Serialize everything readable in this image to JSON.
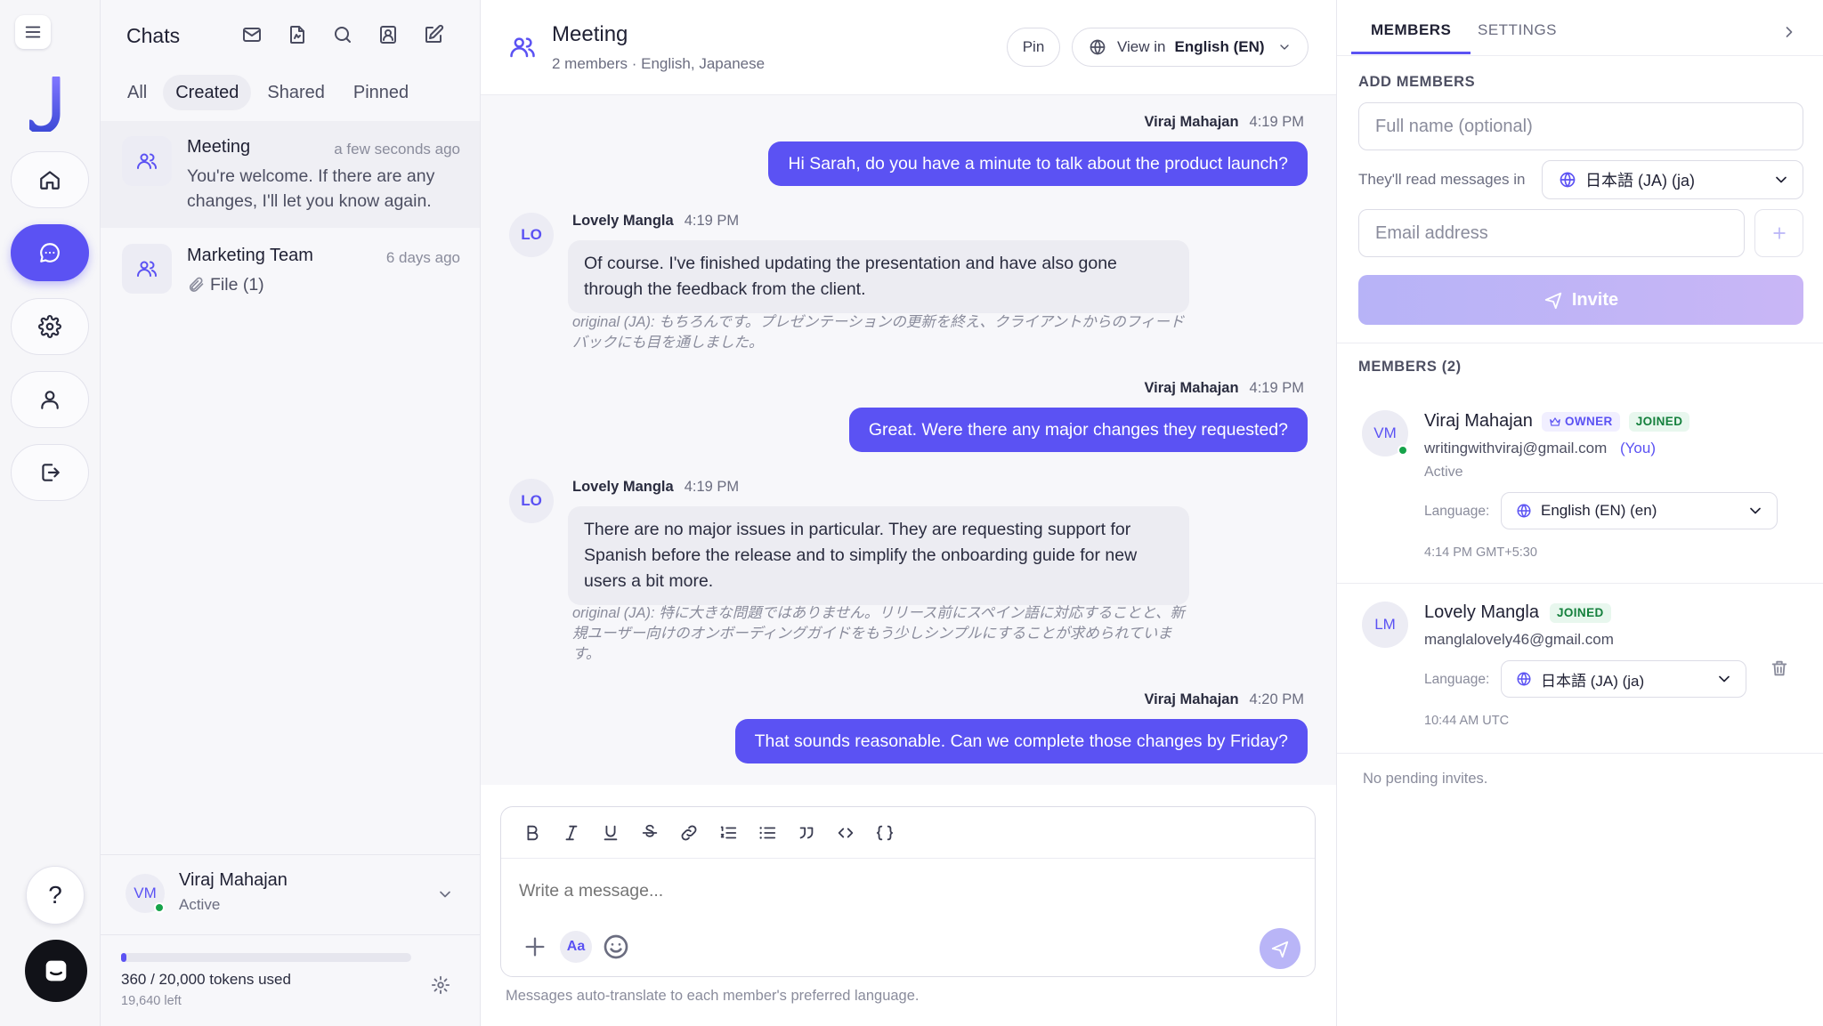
{
  "rail": {
    "help_label": "?",
    "active_color": "#5b52f3"
  },
  "chats_panel": {
    "title": "Chats",
    "filters": [
      "All",
      "Created",
      "Shared",
      "Pinned"
    ],
    "items": [
      {
        "name": "Meeting",
        "time": "a few seconds ago",
        "preview": "You're welcome. If there are any changes, I'll let you know again."
      },
      {
        "name": "Marketing Team",
        "time": "6 days ago",
        "preview": "File (1)"
      }
    ],
    "user": {
      "initials": "VM",
      "name": "Viraj Mahajan",
      "status": "Active"
    },
    "tokens": {
      "used_label": "360 / 20,000 tokens used",
      "left_label": "19,640 left",
      "fraction": 0.018
    }
  },
  "conversation": {
    "title": "Meeting",
    "subtitle": "2 members · English, Japanese",
    "pin_label": "Pin",
    "view_in_label": "View in",
    "view_in_value": "English (EN)",
    "messages": [
      {
        "sender": "Viraj Mahajan",
        "time": "4:19 PM",
        "text": "Hi Sarah, do you have a minute to talk about the product launch?"
      },
      {
        "sender": "Lovely Mangla",
        "initials": "LO",
        "time": "4:19 PM",
        "text": "Of course. I've finished updating the presentation and have also gone through the feedback from the client.",
        "original": "original (JA): もちろんです。プレゼンテーションの更新を終え、クライアントからのフィードバックにも目を通しました。"
      },
      {
        "sender": "Viraj Mahajan",
        "time": "4:19 PM",
        "text": "Great. Were there any major changes they requested?"
      },
      {
        "sender": "Lovely Mangla",
        "initials": "LO",
        "time": "4:19 PM",
        "text": "There are no major issues in particular. They are requesting support for Spanish before the release and to simplify the onboarding guide for new users a bit more.",
        "original": "original (JA): 特に大きな問題ではありません。リリース前にスペイン語に対応することと、新規ユーザー向けのオンボーディングガイドをもう少しシンプルにすることが求められています。"
      },
      {
        "sender": "Viraj Mahajan",
        "time": "4:20 PM",
        "text": "That sounds reasonable. Can we complete those changes by Friday?"
      }
    ],
    "composer": {
      "placeholder": "Write a message...",
      "aa_label": "Aa"
    },
    "hint": "Messages auto-translate to each member's preferred language."
  },
  "right_panel": {
    "tabs": [
      "MEMBERS",
      "SETTINGS"
    ],
    "add_members_label": "ADD MEMBERS",
    "full_name_placeholder": "Full name (optional)",
    "read_in_label": "They'll read messages in",
    "read_in_value": "日本語 (JA) (ja)",
    "email_placeholder": "Email address",
    "invite_label": "Invite",
    "members_label": "MEMBERS (2)",
    "members": [
      {
        "initials": "VM",
        "name": "Viraj Mahajan",
        "owner_badge": "OWNER",
        "joined_badge": "JOINED",
        "email": "writingwithviraj@gmail.com",
        "you_label": "(You)",
        "status": "Active",
        "language_label": "Language:",
        "language": "English (EN) (en)",
        "time": "4:14 PM GMT+5:30"
      },
      {
        "initials": "LM",
        "name": "Lovely Mangla",
        "joined_badge": "JOINED",
        "email": "manglalovely46@gmail.com",
        "language_label": "Language:",
        "language": "日本語 (JA) (ja)",
        "time": "10:44 AM UTC"
      }
    ],
    "no_pending": "No pending invites."
  }
}
